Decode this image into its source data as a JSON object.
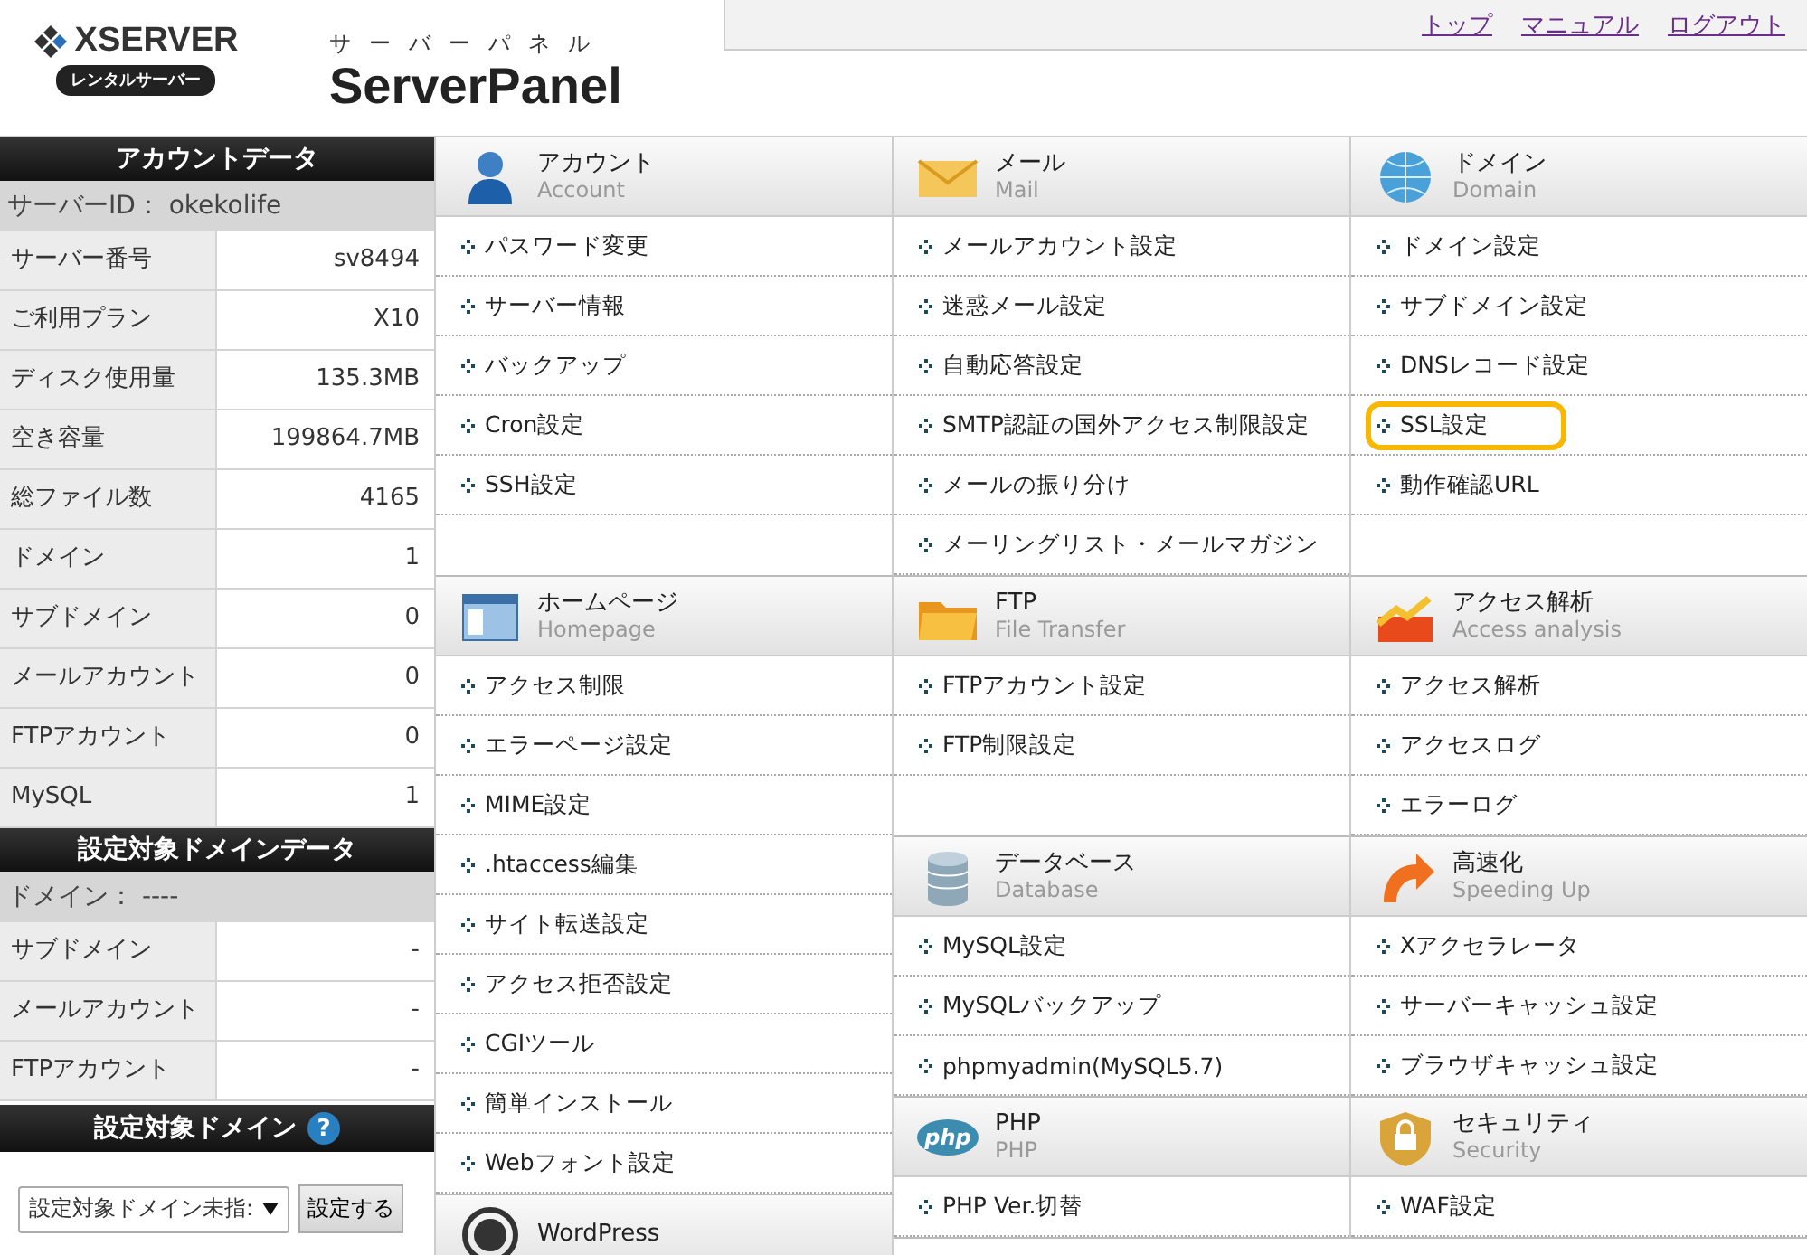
{
  "header": {
    "logo": "XSERVER",
    "logo_badge": "レンタルサーバー",
    "subtitle": "サーバーパネル",
    "title": "ServerPanel",
    "links": [
      "トップ",
      "マニュアル",
      "ログアウト"
    ]
  },
  "sidebar": {
    "account_title": "アカウントデータ",
    "server_id": "サーバーID： okekolife",
    "account_rows": [
      {
        "label": "サーバー番号",
        "value": "sv8494"
      },
      {
        "label": "ご利用プラン",
        "value": "X10"
      },
      {
        "label": "ディスク使用量",
        "value": "135.3MB"
      },
      {
        "label": "空き容量",
        "value": "199864.7MB"
      },
      {
        "label": "総ファイル数",
        "value": "4165"
      },
      {
        "label": "ドメイン",
        "value": "1"
      },
      {
        "label": "サブドメイン",
        "value": "0"
      },
      {
        "label": "メールアカウント",
        "value": "0"
      },
      {
        "label": "FTPアカウント",
        "value": "0"
      },
      {
        "label": "MySQL",
        "value": "1"
      }
    ],
    "domain_title": "設定対象ドメインデータ",
    "domain": "ドメイン： ----",
    "domain_rows": [
      {
        "label": "サブドメイン",
        "value": "-"
      },
      {
        "label": "メールアカウント",
        "value": "-"
      },
      {
        "label": "FTPアカウント",
        "value": "-"
      }
    ],
    "target_title": "設定対象ドメイン",
    "help": "?",
    "select_value": "設定対象ドメイン未指:",
    "set_button": "設定する"
  },
  "top_row": [
    {
      "kind": "account",
      "title": "アカウント",
      "subtitle": "Account",
      "items": [
        {
          "label": "パスワード変更",
          "highlighted": false
        },
        {
          "label": "サーバー情報",
          "highlighted": false
        },
        {
          "label": "バックアップ",
          "highlighted": false
        },
        {
          "label": "Cron設定",
          "highlighted": false
        },
        {
          "label": "SSH設定",
          "highlighted": false
        }
      ]
    },
    {
      "kind": "mail",
      "title": "メール",
      "subtitle": "Mail",
      "items": [
        {
          "label": "メールアカウント設定",
          "highlighted": false
        },
        {
          "label": "迷惑メール設定",
          "highlighted": false
        },
        {
          "label": "自動応答設定",
          "highlighted": false
        },
        {
          "label": "SMTP認証の国外アクセス制限設定",
          "highlighted": false
        },
        {
          "label": "メールの振り分け",
          "highlighted": false
        },
        {
          "label": "メーリングリスト・メールマガジン",
          "highlighted": false
        }
      ]
    },
    {
      "kind": "domain",
      "title": "ドメイン",
      "subtitle": "Domain",
      "items": [
        {
          "label": "ドメイン設定",
          "highlighted": false
        },
        {
          "label": "サブドメイン設定",
          "highlighted": false
        },
        {
          "label": "DNSレコード設定",
          "highlighted": false
        },
        {
          "label": "SSL設定",
          "highlighted": true
        },
        {
          "label": "動作確認URL",
          "highlighted": false
        }
      ]
    }
  ],
  "left_column": [
    {
      "kind": "homepage",
      "title": "ホームページ",
      "subtitle": "Homepage",
      "items": [
        {
          "label": "アクセス制限",
          "highlighted": false
        },
        {
          "label": "エラーページ設定",
          "highlighted": false
        },
        {
          "label": "MIME設定",
          "highlighted": false
        },
        {
          "label": ".htaccess編集",
          "highlighted": false
        },
        {
          "label": "サイト転送設定",
          "highlighted": false
        },
        {
          "label": "アクセス拒否設定",
          "highlighted": false
        },
        {
          "label": "CGIツール",
          "highlighted": false
        },
        {
          "label": "簡単インストール",
          "highlighted": false
        },
        {
          "label": "Webフォント設定",
          "highlighted": false
        }
      ]
    },
    {
      "kind": "wordpress",
      "title": "WordPress"
    }
  ],
  "right_grid": [
    {
      "kind": "ftp",
      "title": "FTP",
      "subtitle": "File Transfer",
      "items": [
        {
          "label": "FTPアカウント設定",
          "highlighted": false
        },
        {
          "label": "FTP制限設定",
          "highlighted": false
        }
      ]
    },
    {
      "kind": "access",
      "title": "アクセス解析",
      "subtitle": "Access analysis",
      "items": [
        {
          "label": "アクセス解析",
          "highlighted": false
        },
        {
          "label": "アクセスログ",
          "highlighted": false
        },
        {
          "label": "エラーログ",
          "highlighted": false
        }
      ]
    },
    {
      "kind": "database",
      "title": "データベース",
      "subtitle": "Database",
      "items": [
        {
          "label": "MySQL設定",
          "highlighted": false
        },
        {
          "label": "MySQLバックアップ",
          "highlighted": false
        },
        {
          "label": "phpmyadmin(MySQL5.7)",
          "highlighted": false
        }
      ]
    },
    {
      "kind": "speed",
      "title": "高速化",
      "subtitle": "Speeding Up",
      "items": [
        {
          "label": "Xアクセラレータ",
          "highlighted": false
        },
        {
          "label": "サーバーキャッシュ設定",
          "highlighted": false
        },
        {
          "label": "ブラウザキャッシュ設定",
          "highlighted": false
        }
      ]
    },
    {
      "kind": "php",
      "badge": "php",
      "title": "PHP",
      "subtitle": "PHP",
      "items": [
        {
          "label": "PHP Ver.切替",
          "highlighted": false
        }
      ]
    },
    {
      "kind": "security",
      "title": "セキュリティ",
      "subtitle": "Security",
      "items": [
        {
          "label": "WAF設定",
          "highlighted": false
        }
      ]
    }
  ]
}
